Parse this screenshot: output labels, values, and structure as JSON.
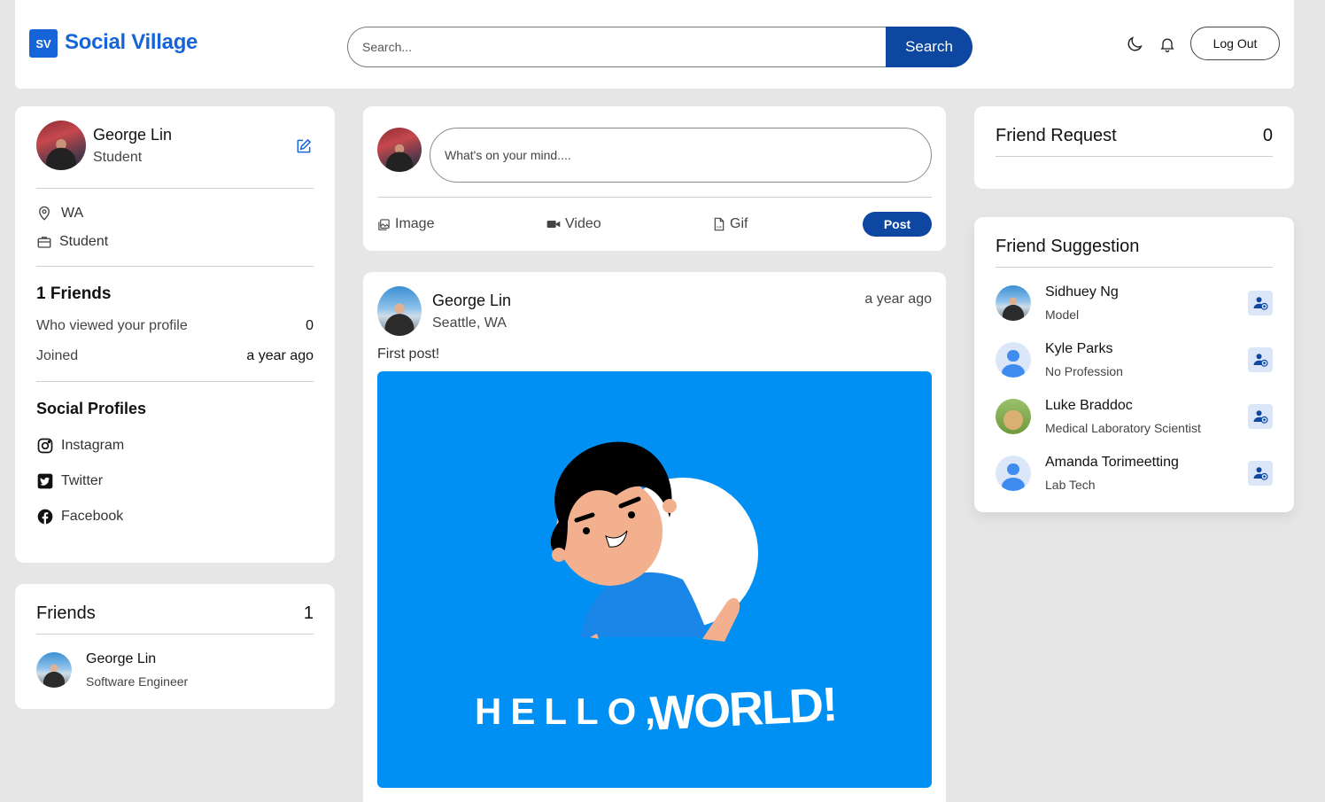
{
  "header": {
    "logo_glyph": "SV",
    "app_title": "Social Village",
    "search": {
      "placeholder": "Search...",
      "button_label": "Search"
    },
    "logout_label": "Log Out",
    "icons": [
      "moon-icon",
      "bell-icon"
    ]
  },
  "profile": {
    "name": "George Lin",
    "occupation": "Student",
    "location": "WA",
    "job": "Student",
    "friends_heading": "1 Friends",
    "viewed_label": "Who viewed your profile",
    "viewed_value": "0",
    "joined_label": "Joined",
    "joined_value": "a year ago",
    "social_heading": "Social Profiles",
    "socials": [
      "Instagram",
      "Twitter",
      "Facebook"
    ]
  },
  "friends_panel": {
    "title": "Friends",
    "count": "1",
    "items": [
      {
        "name": "George Lin",
        "occupation": "Software Engineer"
      }
    ]
  },
  "composer": {
    "placeholder": "What's on your mind....",
    "image_label": "Image",
    "video_label": "Video",
    "gif_label": "Gif",
    "post_label": "Post"
  },
  "post": {
    "author": "George Lin",
    "location": "Seattle, WA",
    "time": "a year ago",
    "text": "First post!",
    "image_caption": "HELLO, WORLD!"
  },
  "friend_request": {
    "title": "Friend Request",
    "count": "0"
  },
  "suggestions": {
    "title": "Friend Suggestion",
    "items": [
      {
        "name": "Sidhuey Ng",
        "occupation": "Model"
      },
      {
        "name": "Kyle Parks",
        "occupation": "No Profession"
      },
      {
        "name": "Luke Braddoc",
        "occupation": "Medical Laboratory Scientist"
      },
      {
        "name": "Amanda Torimeetting",
        "occupation": "Lab Tech"
      }
    ]
  },
  "colors": {
    "brand": "#1565d8",
    "primary_button": "#0d47a1",
    "background": "#e6e6e6",
    "post_image_bg": "#008ff2"
  }
}
